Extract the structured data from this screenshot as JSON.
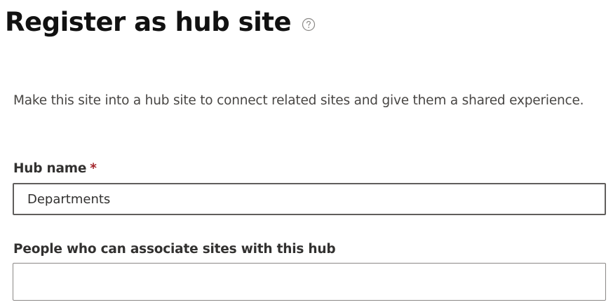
{
  "header": {
    "title": "Register as hub site",
    "help_icon": "help-circle-icon"
  },
  "description": "Make this site into a hub site to connect related sites and give them a shared experience.",
  "form": {
    "hub_name": {
      "label": "Hub name",
      "required_marker": "*",
      "value": "Departments"
    },
    "associate_people": {
      "label": "People who can associate sites with this hub",
      "value": ""
    }
  },
  "colors": {
    "required": "#a4262c",
    "border": "#605e5c",
    "text": "#323130"
  }
}
